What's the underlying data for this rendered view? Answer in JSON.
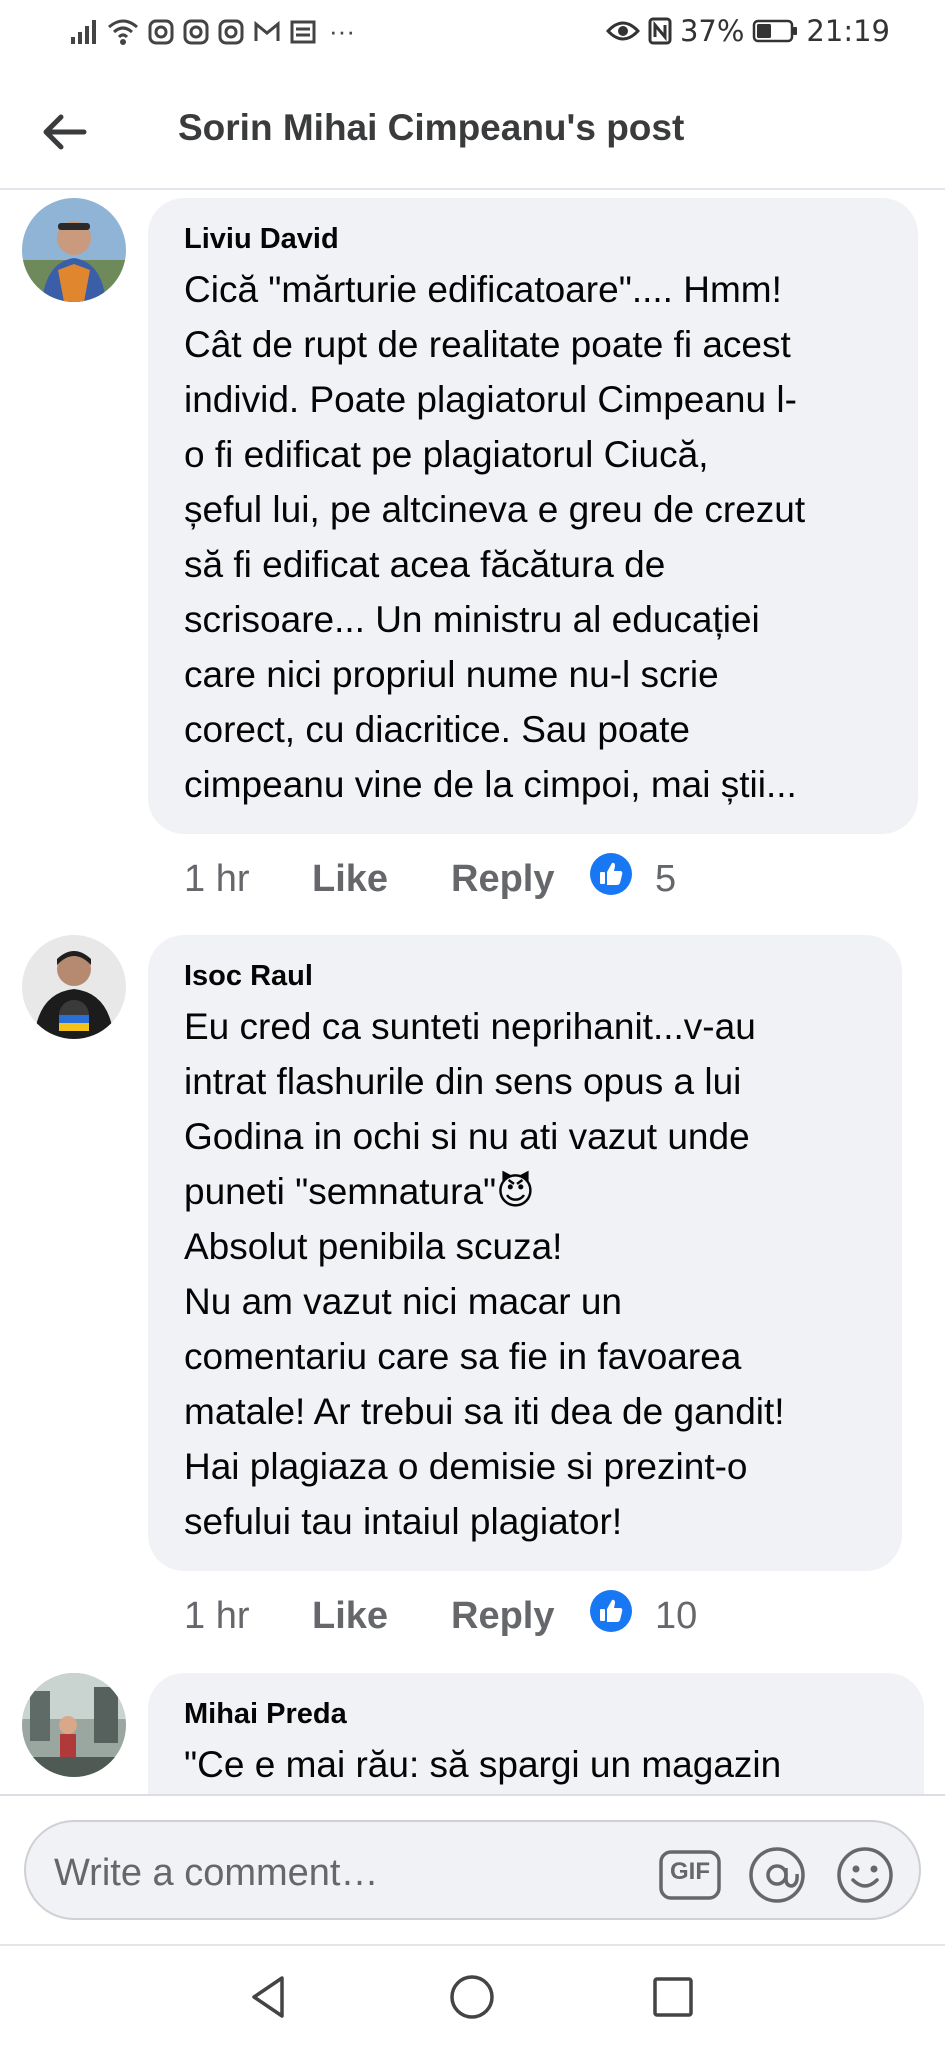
{
  "status_bar": {
    "battery": "37%",
    "time": "21:19",
    "more": "···"
  },
  "header": {
    "title": "Sorin Mihai Cimpeanu's post"
  },
  "comments": [
    {
      "author": "Liviu David",
      "text": "Cică \"mărturie edificatoare\".... Hmm!\nCât de rupt de realitate poate fi acest\nindivid. Poate plagiatorul Cimpeanu l-\no fi edificat pe plagiatorul Ciucă,\nșeful lui, pe altcineva e greu de crezut\nsă fi edificat acea făcătura de\nscrisoare... Un ministru al educației\ncare nici propriul nume nu-l scrie\ncorect, cu diacritice. Sau poate\ncimpeanu vine de la cimpoi, mai știi...",
      "time": "1 hr",
      "like": "Like",
      "reply": "Reply",
      "reactions": "5"
    },
    {
      "author": "Isoc Raul",
      "text": "Eu cred ca sunteti neprihanit...v-au\nintrat flashurile din sens opus a lui\nGodina in ochi si nu ati vazut unde\npuneti \"semnatura\"😈\nAbsolut penibila scuza!\nNu am vazut nici macar un\ncomentariu care sa fie in favoarea\nmatale! Ar trebui sa iti dea de gandit!\nHai plagiaza o demisie si prezint-o\nsefului tau intaiul plagiator!",
      "time": "1 hr",
      "like": "Like",
      "reply": "Reply",
      "reactions": "10"
    },
    {
      "author": "Mihai Preda",
      "text": "\"Ce e mai rău: să spargi un magazin"
    }
  ],
  "composer": {
    "placeholder": "Write a comment…",
    "gif_label": "GIF"
  },
  "colors": {
    "like_blue": "#1877f2",
    "bubble_bg": "#f0f2f5",
    "secondary_text": "#65676b"
  }
}
